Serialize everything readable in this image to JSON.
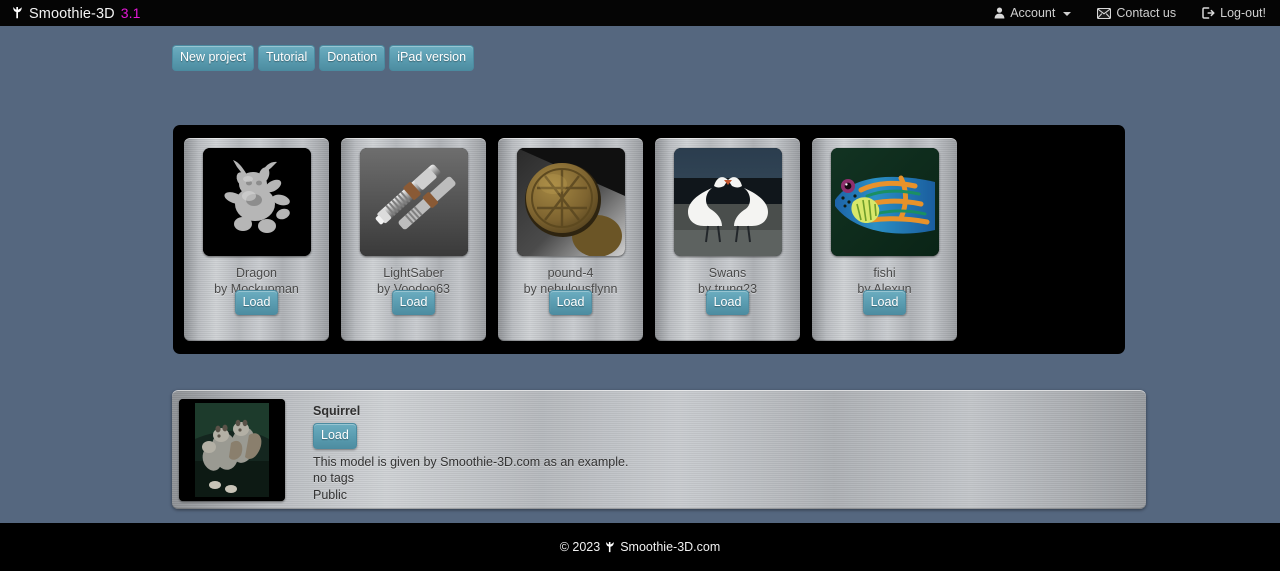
{
  "navbar": {
    "brand_icon": "leaf-logo-icon",
    "brand_name": "Smoothie-3D",
    "version": "3.1",
    "links": [
      {
        "icon": "user-icon",
        "label": "Account",
        "has_caret": true
      },
      {
        "icon": "mail-icon",
        "label": "Contact us",
        "has_caret": false
      },
      {
        "icon": "logout-icon",
        "label": "Log-out!",
        "has_caret": false
      }
    ]
  },
  "toolbar": {
    "buttons": [
      {
        "label": "New project"
      },
      {
        "label": "Tutorial"
      },
      {
        "label": "Donation"
      },
      {
        "label": "iPad version"
      }
    ]
  },
  "gallery": {
    "load_label": "Load",
    "by_prefix": "by ",
    "cards": [
      {
        "title": "Dragon",
        "author": "Mockupman",
        "thumb": "dragon-thumbnail",
        "load_label": "Load"
      },
      {
        "title": "LightSaber",
        "author": "Voodoo63",
        "thumb": "lightsaber-thumbnail",
        "load_label": "Load"
      },
      {
        "title": "pound-4",
        "author": "nebulousflynn",
        "thumb": "coin-thumbnail",
        "load_label": "Load"
      },
      {
        "title": "Swans",
        "author": "trung23",
        "thumb": "swans-thumbnail",
        "load_label": "Load"
      },
      {
        "title": "fishi",
        "author": "Alexun",
        "thumb": "fish-thumbnail",
        "load_label": "Load"
      }
    ]
  },
  "my_models": [
    {
      "name": "Squirrel",
      "load_label": "Load",
      "description": "This model is given by Smoothie-3D.com as an example.",
      "tags": "no tags",
      "visibility": "Public",
      "thumb": "squirrel-thumbnail"
    }
  ],
  "footer": {
    "copyright": "© 2023",
    "icon": "leaf-logo-icon",
    "site": "Smoothie-3D.com"
  },
  "colors": {
    "page_background": "#55677f",
    "navbar_background": "#050505",
    "accent_button": "#5b9db1",
    "version_text": "#e318d6",
    "panel_background": "#000000"
  }
}
